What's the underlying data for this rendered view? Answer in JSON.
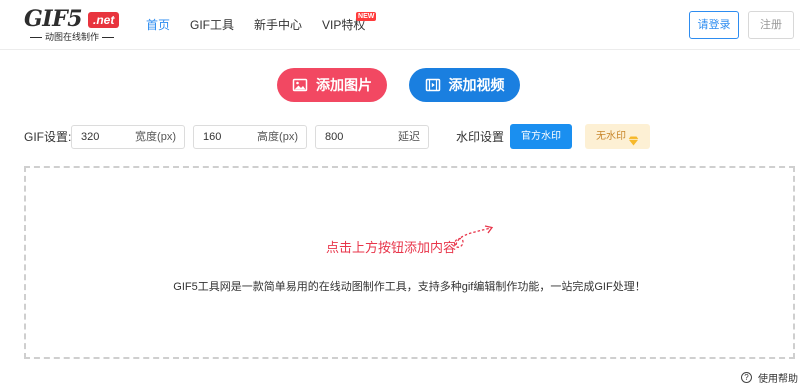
{
  "header": {
    "logo": {
      "main": "GIF5",
      "badge": ".net",
      "subtitle": "动图在线制作"
    },
    "nav": [
      {
        "label": "首页",
        "active": true
      },
      {
        "label": "GIF工具",
        "active": false
      },
      {
        "label": "新手中心",
        "active": false
      },
      {
        "label": "VIP特权",
        "active": false,
        "badge": "NEW"
      }
    ],
    "login_label": "请登录",
    "register_label": "注册"
  },
  "actions": {
    "add_image_label": "添加图片",
    "add_video_label": "添加视频"
  },
  "gif_settings": {
    "label": "GIF设置:",
    "width": {
      "value": "320",
      "unit": "宽度(px)"
    },
    "height": {
      "value": "160",
      "unit": "高度(px)"
    },
    "delay": {
      "value": "800",
      "unit": "延迟"
    },
    "watermark_label": "水印设置",
    "official_watermark_label": "官方水印",
    "no_watermark_label": "无水印"
  },
  "dropzone": {
    "prompt": "点击上方按钮添加内容",
    "description": "GIF5工具网是一款简单易用的在线动图制作工具，支持多种gif编辑制作功能，一站完成GIF处理！"
  },
  "help_label": "使用帮助",
  "colors": {
    "accent_blue": "#2d8cf0",
    "add_image_red": "#f24862",
    "add_video_blue": "#1a7fe0",
    "prompt_red": "#e8364b",
    "no_wm_bg": "#fdf0d4"
  },
  "icons": {
    "add_image": "image-icon",
    "add_video": "film-icon",
    "no_watermark": "diamond-icon",
    "help": "question-circle-icon",
    "prompt_arrow": "curly-arrow-icon"
  }
}
